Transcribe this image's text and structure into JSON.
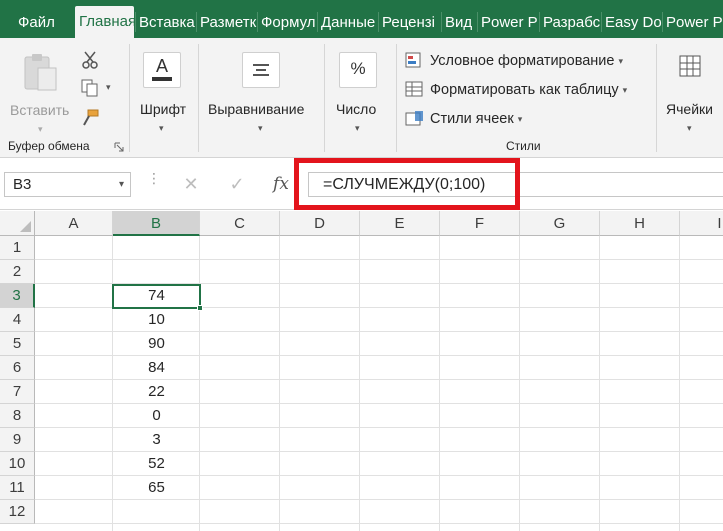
{
  "colors": {
    "accent": "#217346",
    "highlight_box": "#e3141c"
  },
  "tabs": [
    {
      "label": "Файл"
    },
    {
      "label": "Главная",
      "active": true
    },
    {
      "label": "Вставка"
    },
    {
      "label": "Разметк"
    },
    {
      "label": "Формул"
    },
    {
      "label": "Данные"
    },
    {
      "label": "Рецензі"
    },
    {
      "label": "Вид"
    },
    {
      "label": "Power P"
    },
    {
      "label": "Разрабс"
    },
    {
      "label": "Easy Do"
    },
    {
      "label": "Power P"
    }
  ],
  "ribbon": {
    "clipboard": {
      "paste_label": "Вставить",
      "group_label": "Буфер обмена"
    },
    "font": {
      "label": "Шрифт"
    },
    "alignment": {
      "label": "Выравнивание"
    },
    "number": {
      "label": "Число"
    },
    "styles": {
      "conditional_formatting": "Условное форматирование",
      "format_as_table": "Форматировать как таблицу",
      "cell_styles": "Стили ячеек",
      "group_label": "Стили"
    },
    "cells": {
      "label": "Ячейки"
    }
  },
  "formula_bar": {
    "name_box": "B3",
    "fx_label": "fx",
    "formula": "=СЛУЧМЕЖДУ(0;100)"
  },
  "sheet": {
    "columns": [
      "A",
      "B",
      "C",
      "D",
      "E",
      "F",
      "G",
      "H",
      "I"
    ],
    "selected_column": "B",
    "rows": [
      "1",
      "2",
      "3",
      "4",
      "5",
      "6",
      "7",
      "8",
      "9",
      "10",
      "11",
      "12"
    ],
    "selected_row": "3",
    "column_b_values": [
      "",
      "",
      "74",
      "10",
      "90",
      "84",
      "22",
      "0",
      "3",
      "52",
      "65",
      ""
    ]
  }
}
